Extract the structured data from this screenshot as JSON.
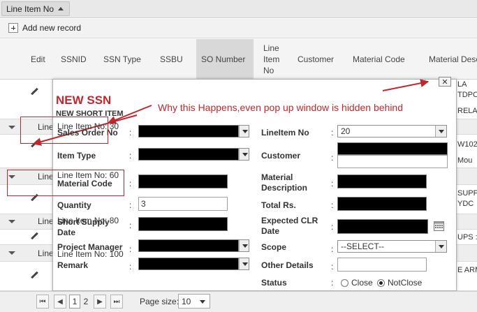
{
  "grouping": {
    "chip_label": "Line Item No"
  },
  "toolbar": {
    "add_label": "Add new record"
  },
  "headers": {
    "edit": "Edit",
    "ssnid": "SSNID",
    "ssn_type": "SSN Type",
    "ssbu": "SSBU",
    "so_number": "SO Number",
    "line_item_no": "Line Item No",
    "customer": "Customer",
    "material_code": "Material Code",
    "material_desc": "Material Desc"
  },
  "groups": [
    {
      "label": "Line Item No: 30"
    },
    {
      "label": "Line Item No: 60"
    },
    {
      "label": "Line Item No: 80"
    },
    {
      "label": "Line Item No: 100"
    }
  ],
  "side_cells": [
    "LA",
    "TDPC",
    "RELA",
    "W102",
    "Mou",
    "SUPP",
    "YDC",
    "UPS :",
    "E ARM"
  ],
  "pager": {
    "page1": "1",
    "page2": "2",
    "page_size_label": "Page size:",
    "page_size_value": "10"
  },
  "popup": {
    "title": "NEW SSN",
    "subtitle": "NEW SHORT ITEM",
    "annotation": "Why this Happens,even pop up window is hidden behind",
    "colon": ":",
    "fields": {
      "sales_order_no": "Sales Order No",
      "item_type": "Item Type",
      "material_code": "Material Code",
      "quantity": "Quantity",
      "quantity_value": "3",
      "short_supply_date": "Short Supply Date",
      "project_manager": "Project Manager",
      "remark": "Remark",
      "line_item_no": "LineItem No",
      "line_item_value": "20",
      "customer": "Customer",
      "material_description": "Material Description",
      "total_rs": "Total Rs.",
      "expected_clr_date": "Expected CLR Date",
      "scope": "Scope",
      "scope_value": "--SELECT--",
      "other_details": "Other Details",
      "status": "Status",
      "status_close": "Close",
      "status_notclose": "NotClose"
    }
  },
  "colors": {
    "accent_red": "#c0272d",
    "black_field": "#000000"
  }
}
